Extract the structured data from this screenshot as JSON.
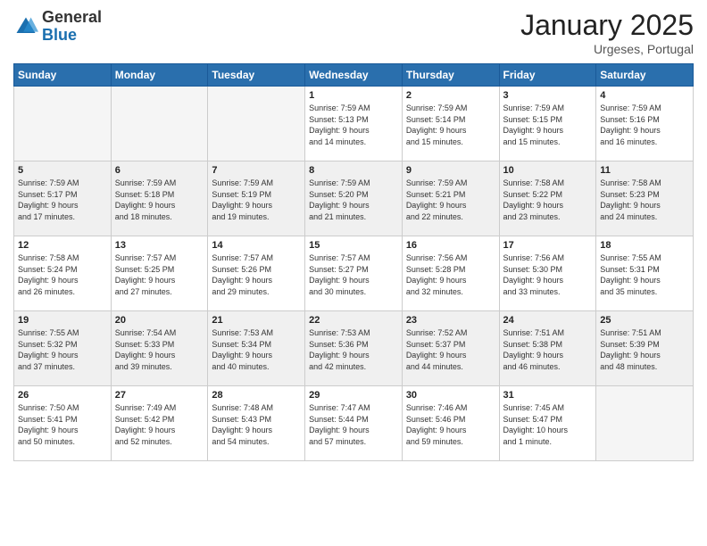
{
  "logo": {
    "general": "General",
    "blue": "Blue"
  },
  "header": {
    "month": "January 2025",
    "location": "Urgeses, Portugal"
  },
  "weekdays": [
    "Sunday",
    "Monday",
    "Tuesday",
    "Wednesday",
    "Thursday",
    "Friday",
    "Saturday"
  ],
  "weeks": [
    [
      {
        "day": "",
        "info": ""
      },
      {
        "day": "",
        "info": ""
      },
      {
        "day": "",
        "info": ""
      },
      {
        "day": "1",
        "info": "Sunrise: 7:59 AM\nSunset: 5:13 PM\nDaylight: 9 hours\nand 14 minutes."
      },
      {
        "day": "2",
        "info": "Sunrise: 7:59 AM\nSunset: 5:14 PM\nDaylight: 9 hours\nand 15 minutes."
      },
      {
        "day": "3",
        "info": "Sunrise: 7:59 AM\nSunset: 5:15 PM\nDaylight: 9 hours\nand 15 minutes."
      },
      {
        "day": "4",
        "info": "Sunrise: 7:59 AM\nSunset: 5:16 PM\nDaylight: 9 hours\nand 16 minutes."
      }
    ],
    [
      {
        "day": "5",
        "info": "Sunrise: 7:59 AM\nSunset: 5:17 PM\nDaylight: 9 hours\nand 17 minutes."
      },
      {
        "day": "6",
        "info": "Sunrise: 7:59 AM\nSunset: 5:18 PM\nDaylight: 9 hours\nand 18 minutes."
      },
      {
        "day": "7",
        "info": "Sunrise: 7:59 AM\nSunset: 5:19 PM\nDaylight: 9 hours\nand 19 minutes."
      },
      {
        "day": "8",
        "info": "Sunrise: 7:59 AM\nSunset: 5:20 PM\nDaylight: 9 hours\nand 21 minutes."
      },
      {
        "day": "9",
        "info": "Sunrise: 7:59 AM\nSunset: 5:21 PM\nDaylight: 9 hours\nand 22 minutes."
      },
      {
        "day": "10",
        "info": "Sunrise: 7:58 AM\nSunset: 5:22 PM\nDaylight: 9 hours\nand 23 minutes."
      },
      {
        "day": "11",
        "info": "Sunrise: 7:58 AM\nSunset: 5:23 PM\nDaylight: 9 hours\nand 24 minutes."
      }
    ],
    [
      {
        "day": "12",
        "info": "Sunrise: 7:58 AM\nSunset: 5:24 PM\nDaylight: 9 hours\nand 26 minutes."
      },
      {
        "day": "13",
        "info": "Sunrise: 7:57 AM\nSunset: 5:25 PM\nDaylight: 9 hours\nand 27 minutes."
      },
      {
        "day": "14",
        "info": "Sunrise: 7:57 AM\nSunset: 5:26 PM\nDaylight: 9 hours\nand 29 minutes."
      },
      {
        "day": "15",
        "info": "Sunrise: 7:57 AM\nSunset: 5:27 PM\nDaylight: 9 hours\nand 30 minutes."
      },
      {
        "day": "16",
        "info": "Sunrise: 7:56 AM\nSunset: 5:28 PM\nDaylight: 9 hours\nand 32 minutes."
      },
      {
        "day": "17",
        "info": "Sunrise: 7:56 AM\nSunset: 5:30 PM\nDaylight: 9 hours\nand 33 minutes."
      },
      {
        "day": "18",
        "info": "Sunrise: 7:55 AM\nSunset: 5:31 PM\nDaylight: 9 hours\nand 35 minutes."
      }
    ],
    [
      {
        "day": "19",
        "info": "Sunrise: 7:55 AM\nSunset: 5:32 PM\nDaylight: 9 hours\nand 37 minutes."
      },
      {
        "day": "20",
        "info": "Sunrise: 7:54 AM\nSunset: 5:33 PM\nDaylight: 9 hours\nand 39 minutes."
      },
      {
        "day": "21",
        "info": "Sunrise: 7:53 AM\nSunset: 5:34 PM\nDaylight: 9 hours\nand 40 minutes."
      },
      {
        "day": "22",
        "info": "Sunrise: 7:53 AM\nSunset: 5:36 PM\nDaylight: 9 hours\nand 42 minutes."
      },
      {
        "day": "23",
        "info": "Sunrise: 7:52 AM\nSunset: 5:37 PM\nDaylight: 9 hours\nand 44 minutes."
      },
      {
        "day": "24",
        "info": "Sunrise: 7:51 AM\nSunset: 5:38 PM\nDaylight: 9 hours\nand 46 minutes."
      },
      {
        "day": "25",
        "info": "Sunrise: 7:51 AM\nSunset: 5:39 PM\nDaylight: 9 hours\nand 48 minutes."
      }
    ],
    [
      {
        "day": "26",
        "info": "Sunrise: 7:50 AM\nSunset: 5:41 PM\nDaylight: 9 hours\nand 50 minutes."
      },
      {
        "day": "27",
        "info": "Sunrise: 7:49 AM\nSunset: 5:42 PM\nDaylight: 9 hours\nand 52 minutes."
      },
      {
        "day": "28",
        "info": "Sunrise: 7:48 AM\nSunset: 5:43 PM\nDaylight: 9 hours\nand 54 minutes."
      },
      {
        "day": "29",
        "info": "Sunrise: 7:47 AM\nSunset: 5:44 PM\nDaylight: 9 hours\nand 57 minutes."
      },
      {
        "day": "30",
        "info": "Sunrise: 7:46 AM\nSunset: 5:46 PM\nDaylight: 9 hours\nand 59 minutes."
      },
      {
        "day": "31",
        "info": "Sunrise: 7:45 AM\nSunset: 5:47 PM\nDaylight: 10 hours\nand 1 minute."
      },
      {
        "day": "",
        "info": ""
      }
    ]
  ]
}
